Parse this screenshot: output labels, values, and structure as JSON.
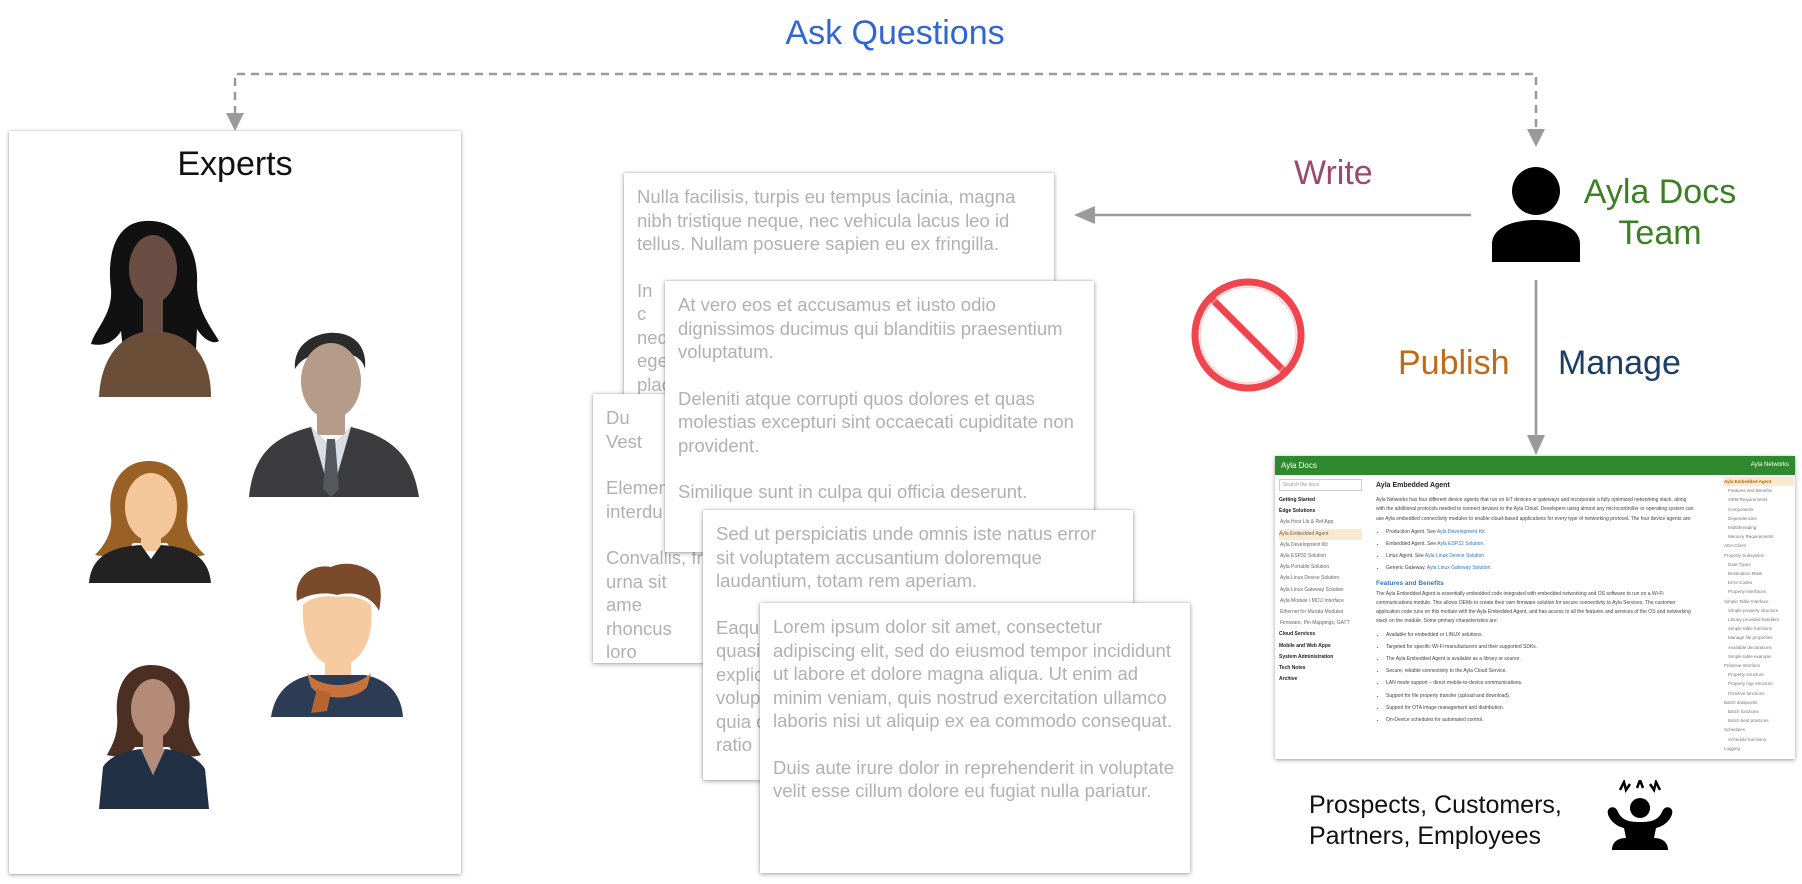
{
  "diagram": {
    "top_label": "Ask Questions",
    "experts": {
      "title": "Experts"
    },
    "team": {
      "line1": "Ayla Docs",
      "line2": "Team"
    },
    "edges": {
      "write": "Write",
      "publish": "Publish",
      "manage": "Manage"
    },
    "audience": {
      "line1": "Prospects, Customers,",
      "line2": "Partners, Employees"
    }
  },
  "colors": {
    "ask": "#2f66d3",
    "write": "#9a4a70",
    "publish": "#c06a18",
    "manage": "#1c3d66",
    "team": "#3d7f22",
    "prohibit": "#f0454d",
    "arrow": "#9a9a9a"
  },
  "icons": [
    "person-icon",
    "prohibited-icon",
    "frustrated-person-icon"
  ],
  "cards": {
    "c1": {
      "p1": "Nulla facilisis, turpis eu tempus lacinia, magna nibh tristique neque, nec vehicula lacus leo id tellus. Nullam posuere sapien eu ex fringilla.",
      "p2": "In c neq ege plac"
    },
    "c2": {
      "p1": "Du Vest",
      "p2": "Elemen interdu",
      "p3": "Convallis, fr urna sit ame rhoncus loro"
    },
    "c3": {
      "p1": "At vero eos et accusamus et iusto odio dignissimos ducimus qui blanditiis praesentium voluptatum.",
      "p2": "Deleniti atque corrupti quos dolores et quas molestias excepturi sint occaecati cupiditate non provident.",
      "p3": "Similique sunt in culpa qui officia deserunt."
    },
    "c4": {
      "p1": "Sed ut perspiciatis unde omnis iste natus error sit voluptatem accusantium doloremque laudantium, totam rem aperiam.",
      "p2": "Eaque quasi explic volup quia c ratio"
    },
    "c5": {
      "p1": "Lorem ipsum dolor sit amet, consectetur adipiscing elit, sed do eiusmod tempor incididunt ut labore et dolore magna aliqua. Ut enim ad minim veniam, quis nostrud exercitation ullamco laboris nisi ut aliquip ex ea commodo consequat.",
      "p2": "Duis aute irure dolor in reprehenderit in voluptate velit esse cillum dolore eu fugiat nulla pariatur."
    }
  },
  "portal": {
    "brand": "Ayla Docs",
    "brand_right": "Ayla Networks",
    "search_placeholder": "Search the docs",
    "nav": [
      {
        "label": "Getting Started",
        "kind": "b"
      },
      {
        "label": "Edge Solutions",
        "kind": "b"
      },
      {
        "label": "Ayla Host Lib & Ref App",
        "kind": "s"
      },
      {
        "label": "Ayla Embedded Agent",
        "kind": "hl"
      },
      {
        "label": "Ayla Development Kit",
        "kind": "s"
      },
      {
        "label": "Ayla ESP32 Solution",
        "kind": "s"
      },
      {
        "label": "Ayla Portable Solution",
        "kind": "s"
      },
      {
        "label": "Ayla Linux Device Solution",
        "kind": "s"
      },
      {
        "label": "Ayla Linux Gateway Solution",
        "kind": "s"
      },
      {
        "label": "Ayla Module / MCU Interface",
        "kind": "s"
      },
      {
        "label": "Ethernet for Murata Modules",
        "kind": "s"
      },
      {
        "label": "Firmware, Pin Mappings, GATT",
        "kind": "s"
      },
      {
        "label": "Cloud Services",
        "kind": "b"
      },
      {
        "label": "Mobile and Web Apps",
        "kind": "b"
      },
      {
        "label": "System Administration",
        "kind": "b"
      },
      {
        "label": "Tech Notes",
        "kind": "b"
      },
      {
        "label": "Archive",
        "kind": "b"
      }
    ],
    "heading": "Ayla Embedded Agent",
    "intro": "Ayla Networks has four different device agents that run on IoT devices or gateways and incorporate a fully optimized networking stack, along with the additional protocols needed to connect devices to the Ayla Cloud. Developers using almost any microcontroller or operating system can use Ayla embedded connectivity modules to enable cloud-based applications for every type of networking protocol. The four device agents are:",
    "agents": [
      {
        "text": "Production Agent. See ",
        "link": "Ayla Development Kit."
      },
      {
        "text": "Embedded Agent. See ",
        "link": "Ayla ESP32 Solution."
      },
      {
        "text": "Linux Agent. See ",
        "link": "Ayla Linux Device Solution."
      },
      {
        "text": "Generic Gateway. ",
        "link": "Ayla Linux Gateway Solution."
      }
    ],
    "features_heading": "Features and Benefits",
    "features_intro": "The Ayla Embedded Agent is essentially embedded code integrated with embedded networking and OS software to run on a Wi-Fi communications module. This allows OEMs to create their own firmware solution for secure connectivity to Ayla Services. The customer application code runs on this module with the Ayla Embedded Agent, and has access to all the features and services of the OS and networking stack on the module. Some primary characteristics are:",
    "features": [
      "Available for embedded or LINUX solutions.",
      "Targeted for specific Wi-Fi manufacturers and their supported SDKs.",
      "The Ayla Embedded Agent is available as a library or source.",
      "Secure, reliable connectivity to the Ayla Cloud Service.",
      "LAN mode support – direct mobile-to-device communications.",
      "Support for file property transfer (upload and download).",
      "Support for OTA image management and distribution.",
      "On-Device schedules for automated control."
    ],
    "toc": [
      {
        "label": "Ayla Embedded Agent",
        "lvl": "act"
      },
      {
        "label": "Features and Benefits",
        "lvl": "i1"
      },
      {
        "label": "OEM Requirements",
        "lvl": "i1"
      },
      {
        "label": "Components",
        "lvl": "i1"
      },
      {
        "label": "Dependencies",
        "lvl": "i1"
      },
      {
        "label": "Multithreading",
        "lvl": "i1"
      },
      {
        "label": "Memory Requirements",
        "lvl": "i1"
      },
      {
        "label": "ADA Client",
        "lvl": "i0"
      },
      {
        "label": "Property Subsystem",
        "lvl": "i0"
      },
      {
        "label": "Data Types",
        "lvl": "i1"
      },
      {
        "label": "Destination Mask",
        "lvl": "i1"
      },
      {
        "label": "Error Codes",
        "lvl": "i1"
      },
      {
        "label": "Property Interfaces",
        "lvl": "i1"
      },
      {
        "label": "Simple Table Interface",
        "lvl": "i0"
      },
      {
        "label": "Simple property structure",
        "lvl": "i1"
      },
      {
        "label": "Library-provided handlers",
        "lvl": "i1"
      },
      {
        "label": "Simple table functions",
        "lvl": "i1"
      },
      {
        "label": "Manage file properties",
        "lvl": "i1"
      },
      {
        "label": "Available declarations",
        "lvl": "i1"
      },
      {
        "label": "Simple table example",
        "lvl": "i1"
      },
      {
        "label": "Primitive Interface",
        "lvl": "i0"
      },
      {
        "label": "Property structure",
        "lvl": "i1"
      },
      {
        "label": "Property mgr structure",
        "lvl": "i1"
      },
      {
        "label": "Primitive functions",
        "lvl": "i1"
      },
      {
        "label": "Batch datapoints",
        "lvl": "i0"
      },
      {
        "label": "Batch functions",
        "lvl": "i1"
      },
      {
        "label": "Batch best practices",
        "lvl": "i1"
      },
      {
        "label": "Schedules",
        "lvl": "i0"
      },
      {
        "label": "Schedule functions",
        "lvl": "i1"
      },
      {
        "label": "Logging",
        "lvl": "i0"
      }
    ]
  }
}
